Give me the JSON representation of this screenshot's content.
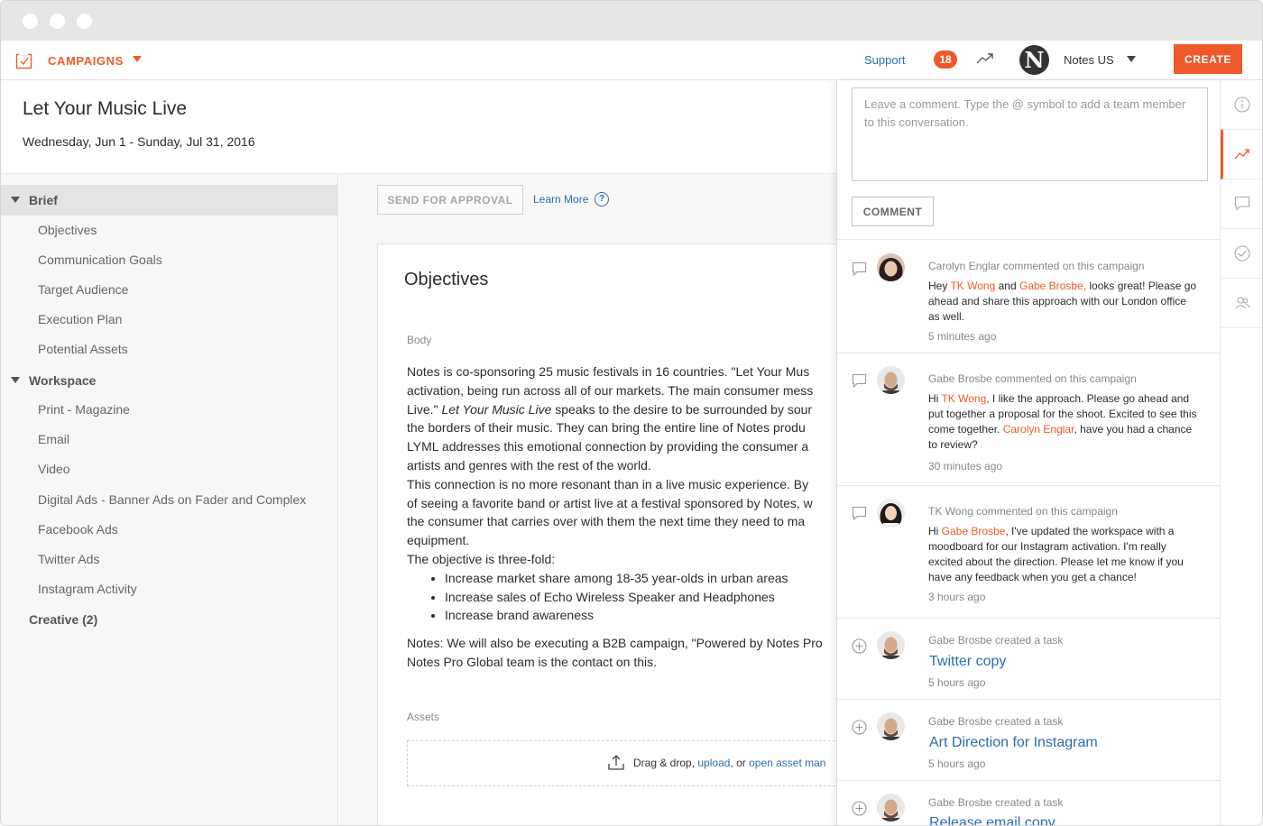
{
  "topbar": {
    "brand_label": "CAMPAIGNS",
    "support_label": "Support",
    "notification_count": "18",
    "avatar_letter": "N",
    "account_name": "Notes US",
    "create_label": "CREATE"
  },
  "campaign": {
    "title": "Let Your Music Live",
    "dates": "Wednesday, Jun 1 - Sunday, Jul 31, 2016"
  },
  "sidebar": {
    "sections": [
      {
        "label": "Brief",
        "items": [
          "Objectives",
          "Communication Goals",
          "Target Audience",
          "Execution Plan",
          "Potential Assets"
        ]
      },
      {
        "label": "Workspace",
        "items": [
          "Print - Magazine",
          "Email",
          "Video",
          "Digital Ads - Banner Ads on Fader and Complex",
          "Facebook Ads",
          "Twitter Ads",
          "Instagram Activity"
        ]
      },
      {
        "label": "Creative (2)",
        "items": []
      }
    ]
  },
  "main": {
    "send_label": "SEND FOR APPROVAL",
    "learn_more_label": "Learn More",
    "help_glyph": "?",
    "card_title": "Objectives",
    "body_label": "Body",
    "body_lines": [
      "Notes is co-sponsoring 25 music festivals in 16 countries. \"Let Your Mus",
      "activation, being run across all of our markets. The main consumer mess",
      "the borders of their music. They can bring the entire line of Notes produ",
      "LYML addresses this emotional connection by providing the consumer a",
      "artists and genres with the rest of the world.",
      "This connection is no more resonant than in a live music experience. By",
      "of seeing a favorite band or artist live at a festival sponsored by Notes, w",
      "the consumer that carries over with them the next time they need to ma",
      "equipment.",
      "The objective is three-fold:"
    ],
    "body_italic_line": {
      "before": "Live.\"  ",
      "italic": "Let Your Music Live",
      "after": " speaks to the desire to be surrounded by sour"
    },
    "bullets": [
      "Increase market share among 18-35 year-olds in urban areas",
      "Increase sales of Echo Wireless Speaker and Headphones",
      "Increase brand awareness"
    ],
    "closing_lines": [
      "Notes: We will also be executing a B2B campaign, \"Powered by Notes Pro",
      "Notes Pro Global team is the contact on this."
    ],
    "assets_label": "Assets",
    "drop_text_before": "Drag & drop, ",
    "upload_link": "upload",
    "drop_text_middle": ", or ",
    "asset_manager_link": "open asset man"
  },
  "comments": {
    "placeholder": "Leave a comment. Type the @ symbol to add a team member to this conversation.",
    "comment_button": "COMMENT",
    "feed": [
      {
        "head": "Carolyn Englar commented on this campaign",
        "time": "5 minutes ago"
      },
      {
        "head": "Gabe Brosbe commented on this campaign",
        "time": "30 minutes ago"
      },
      {
        "head": "TK Wong commented on this campaign",
        "time": "3 hours ago"
      },
      {
        "head": "Gabe Brosbe created a task",
        "task": "Twitter copy",
        "time": "5 hours ago"
      },
      {
        "head": "Gabe Brosbe created a task",
        "task": "Art Direction for Instagram",
        "time": "5 hours ago"
      },
      {
        "head": "Gabe Brosbe created a task",
        "task": "Release email copy"
      }
    ],
    "c1": {
      "t1": "Hey ",
      "m1": "TK Wong",
      "t2": " and ",
      "m2": "Gabe Brosbe,",
      "t3": " looks great! Please go ahead and share this approach with our London office as well."
    },
    "c2": {
      "t1": "Hi ",
      "m1": "TK Wong",
      "t2": ", I like the approach. Please go ahead and put together a proposal for the shoot. Excited to see this come together. ",
      "m2": "Carolyn Englar",
      "t3": ", have you had a chance to review?"
    },
    "c3": {
      "t1": "Hi ",
      "m1": "Gabe Brosbe",
      "t2": ", I've updated the workspace with a moodboard for our Instagram activation. I'm really excited about the direction. Please let me know if you have any feedback when you get a chance!"
    }
  },
  "colors": {
    "accent": "#f0592a",
    "link": "#2a6ead"
  },
  "icons": {
    "brand": "checkbox-icon",
    "trend": "trending-up-icon",
    "comment": "speech-bubble-icon",
    "task": "plus-circle-icon",
    "rail": [
      "info-icon",
      "trending-up-icon",
      "speech-bubble-icon",
      "check-circle-icon",
      "people-icon"
    ]
  }
}
